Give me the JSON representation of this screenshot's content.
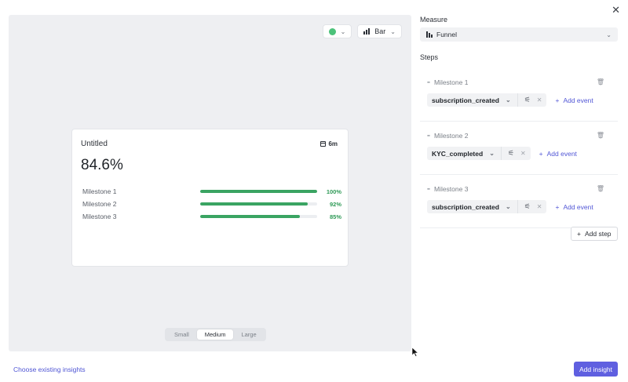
{
  "preview": {
    "color_control": {
      "color": "#4cc27a"
    },
    "chart_type": {
      "label": "Bar",
      "icon": "bar-chart-icon"
    },
    "card": {
      "title": "Untitled",
      "period": "6m",
      "value": "84.6%",
      "milestones": [
        {
          "label": "Milestone 1",
          "pct_label": "100%",
          "fraction": 1.0
        },
        {
          "label": "Milestone 2",
          "pct_label": "92%",
          "fraction": 0.92
        },
        {
          "label": "Milestone 3",
          "pct_label": "85%",
          "fraction": 0.85
        }
      ]
    },
    "sizes": [
      "Small",
      "Medium",
      "Large"
    ],
    "selected_size": "Medium"
  },
  "panel": {
    "measure_label": "Measure",
    "measure_value": "Funnel",
    "steps_label": "Steps",
    "steps": [
      {
        "name": "Milestone 1",
        "event": "subscription_created",
        "add_event": "Add event"
      },
      {
        "name": "Milestone 2",
        "event": "KYC_completed",
        "add_event": "Add event"
      },
      {
        "name": "Milestone 3",
        "event": "subscription_created",
        "add_event": "Add event"
      }
    ],
    "add_step": "Add step"
  },
  "footer": {
    "choose_link": "Choose existing insights",
    "add_insight": "Add insight"
  },
  "colors": {
    "accent": "#5f5fe0",
    "success": "#3aa462"
  }
}
